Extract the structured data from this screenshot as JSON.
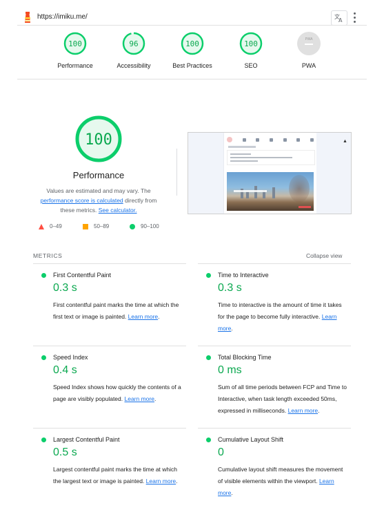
{
  "header": {
    "url": "https://imiku.me/",
    "icons": {
      "logo": "lighthouse-icon",
      "translate": "translate-icon",
      "menu": "more-vert-icon"
    }
  },
  "categories": [
    {
      "id": "performance",
      "score": "100",
      "label": "Performance",
      "status": "pass"
    },
    {
      "id": "accessibility",
      "score": "96",
      "label": "Accessibility",
      "status": "pass"
    },
    {
      "id": "best-practices",
      "score": "100",
      "label": "Best Practices",
      "status": "pass"
    },
    {
      "id": "seo",
      "score": "100",
      "label": "SEO",
      "status": "pass"
    },
    {
      "id": "pwa",
      "score": "PWA",
      "label": "PWA",
      "status": "na"
    }
  ],
  "summary": {
    "score": "100",
    "title": "Performance",
    "desc_prefix": "Values are estimated and may vary. The ",
    "desc_link1": "performance score is calculated",
    "desc_mid": " directly from these metrics. ",
    "desc_link2": "See calculator."
  },
  "legend": [
    {
      "range": "0–49",
      "shape": "triangle",
      "color": "#ff4e42"
    },
    {
      "range": "50–89",
      "shape": "square",
      "color": "#ffa400"
    },
    {
      "range": "90–100",
      "shape": "circle",
      "color": "#0cce6b"
    }
  ],
  "metrics_section": {
    "heading": "METRICS",
    "toggle": "Collapse view",
    "learn_more": "Learn more",
    "items": [
      {
        "title": "First Contentful Paint",
        "value": "0.3 s",
        "desc": "First contentful paint marks the time at which the first text or image is painted."
      },
      {
        "title": "Time to Interactive",
        "value": "0.3 s",
        "desc": "Time to interactive is the amount of time it takes for the page to become fully interactive."
      },
      {
        "title": "Speed Index",
        "value": "0.4 s",
        "desc": "Speed Index shows how quickly the contents of a page are visibly populated."
      },
      {
        "title": "Total Blocking Time",
        "value": "0 ms",
        "desc": "Sum of all time periods between FCP and Time to Interactive, when task length exceeded 50ms, expressed in milliseconds."
      },
      {
        "title": "Largest Contentful Paint",
        "value": "0.5 s",
        "desc": "Largest contentful paint marks the time at which the largest text or image is painted."
      },
      {
        "title": "Cumulative Layout Shift",
        "value": "0",
        "desc": "Cumulative layout shift measures the movement of visible elements within the viewport."
      }
    ]
  },
  "colors": {
    "pass": "#0cce6b",
    "pass_text": "#0aa84f",
    "pass_bg": "#e6f9ee",
    "na": "#cccccc",
    "link": "#1a73e8"
  }
}
